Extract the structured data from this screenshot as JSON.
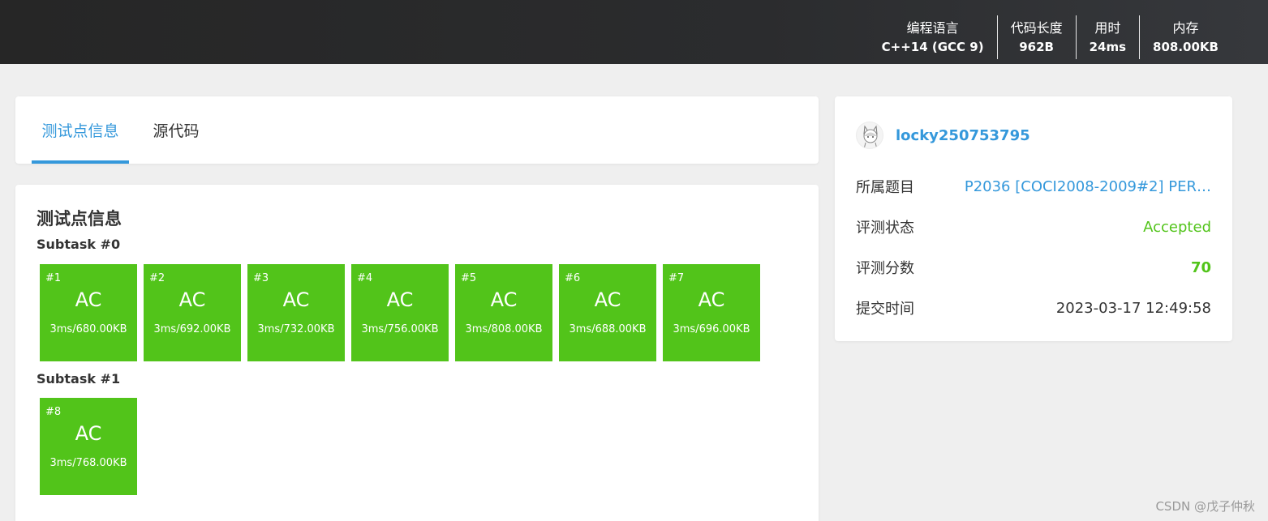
{
  "header": {
    "stats": [
      {
        "label": "编程语言",
        "value": "C++14 (GCC 9)"
      },
      {
        "label": "代码长度",
        "value": "962B"
      },
      {
        "label": "用时",
        "value": "24ms"
      },
      {
        "label": "内存",
        "value": "808.00KB"
      }
    ]
  },
  "tabs": [
    {
      "label": "测试点信息",
      "active": true
    },
    {
      "label": "源代码",
      "active": false
    }
  ],
  "main": {
    "title": "测试点信息",
    "subtasks": [
      {
        "title": "Subtask #0",
        "cases": [
          {
            "id": "#1",
            "result": "AC",
            "meta": "3ms/680.00KB"
          },
          {
            "id": "#2",
            "result": "AC",
            "meta": "3ms/692.00KB"
          },
          {
            "id": "#3",
            "result": "AC",
            "meta": "3ms/732.00KB"
          },
          {
            "id": "#4",
            "result": "AC",
            "meta": "3ms/756.00KB"
          },
          {
            "id": "#5",
            "result": "AC",
            "meta": "3ms/808.00KB"
          },
          {
            "id": "#6",
            "result": "AC",
            "meta": "3ms/688.00KB"
          },
          {
            "id": "#7",
            "result": "AC",
            "meta": "3ms/696.00KB"
          }
        ]
      },
      {
        "title": "Subtask #1",
        "cases": [
          {
            "id": "#8",
            "result": "AC",
            "meta": "3ms/768.00KB"
          }
        ]
      }
    ]
  },
  "side": {
    "username": "locky250753795",
    "rows": [
      {
        "label": "所属题目",
        "value": "P2036 [COCI2008-2009#2] PER…"
      },
      {
        "label": "评测状态",
        "value": "Accepted"
      },
      {
        "label": "评测分数",
        "value": "70"
      },
      {
        "label": "提交时间",
        "value": "2023-03-17 12:49:58"
      }
    ]
  },
  "watermark": "CSDN @戊子仲秋",
  "colors": {
    "accent": "#3498db",
    "ac": "#52c41a",
    "topbar": "#2b2c2e"
  }
}
